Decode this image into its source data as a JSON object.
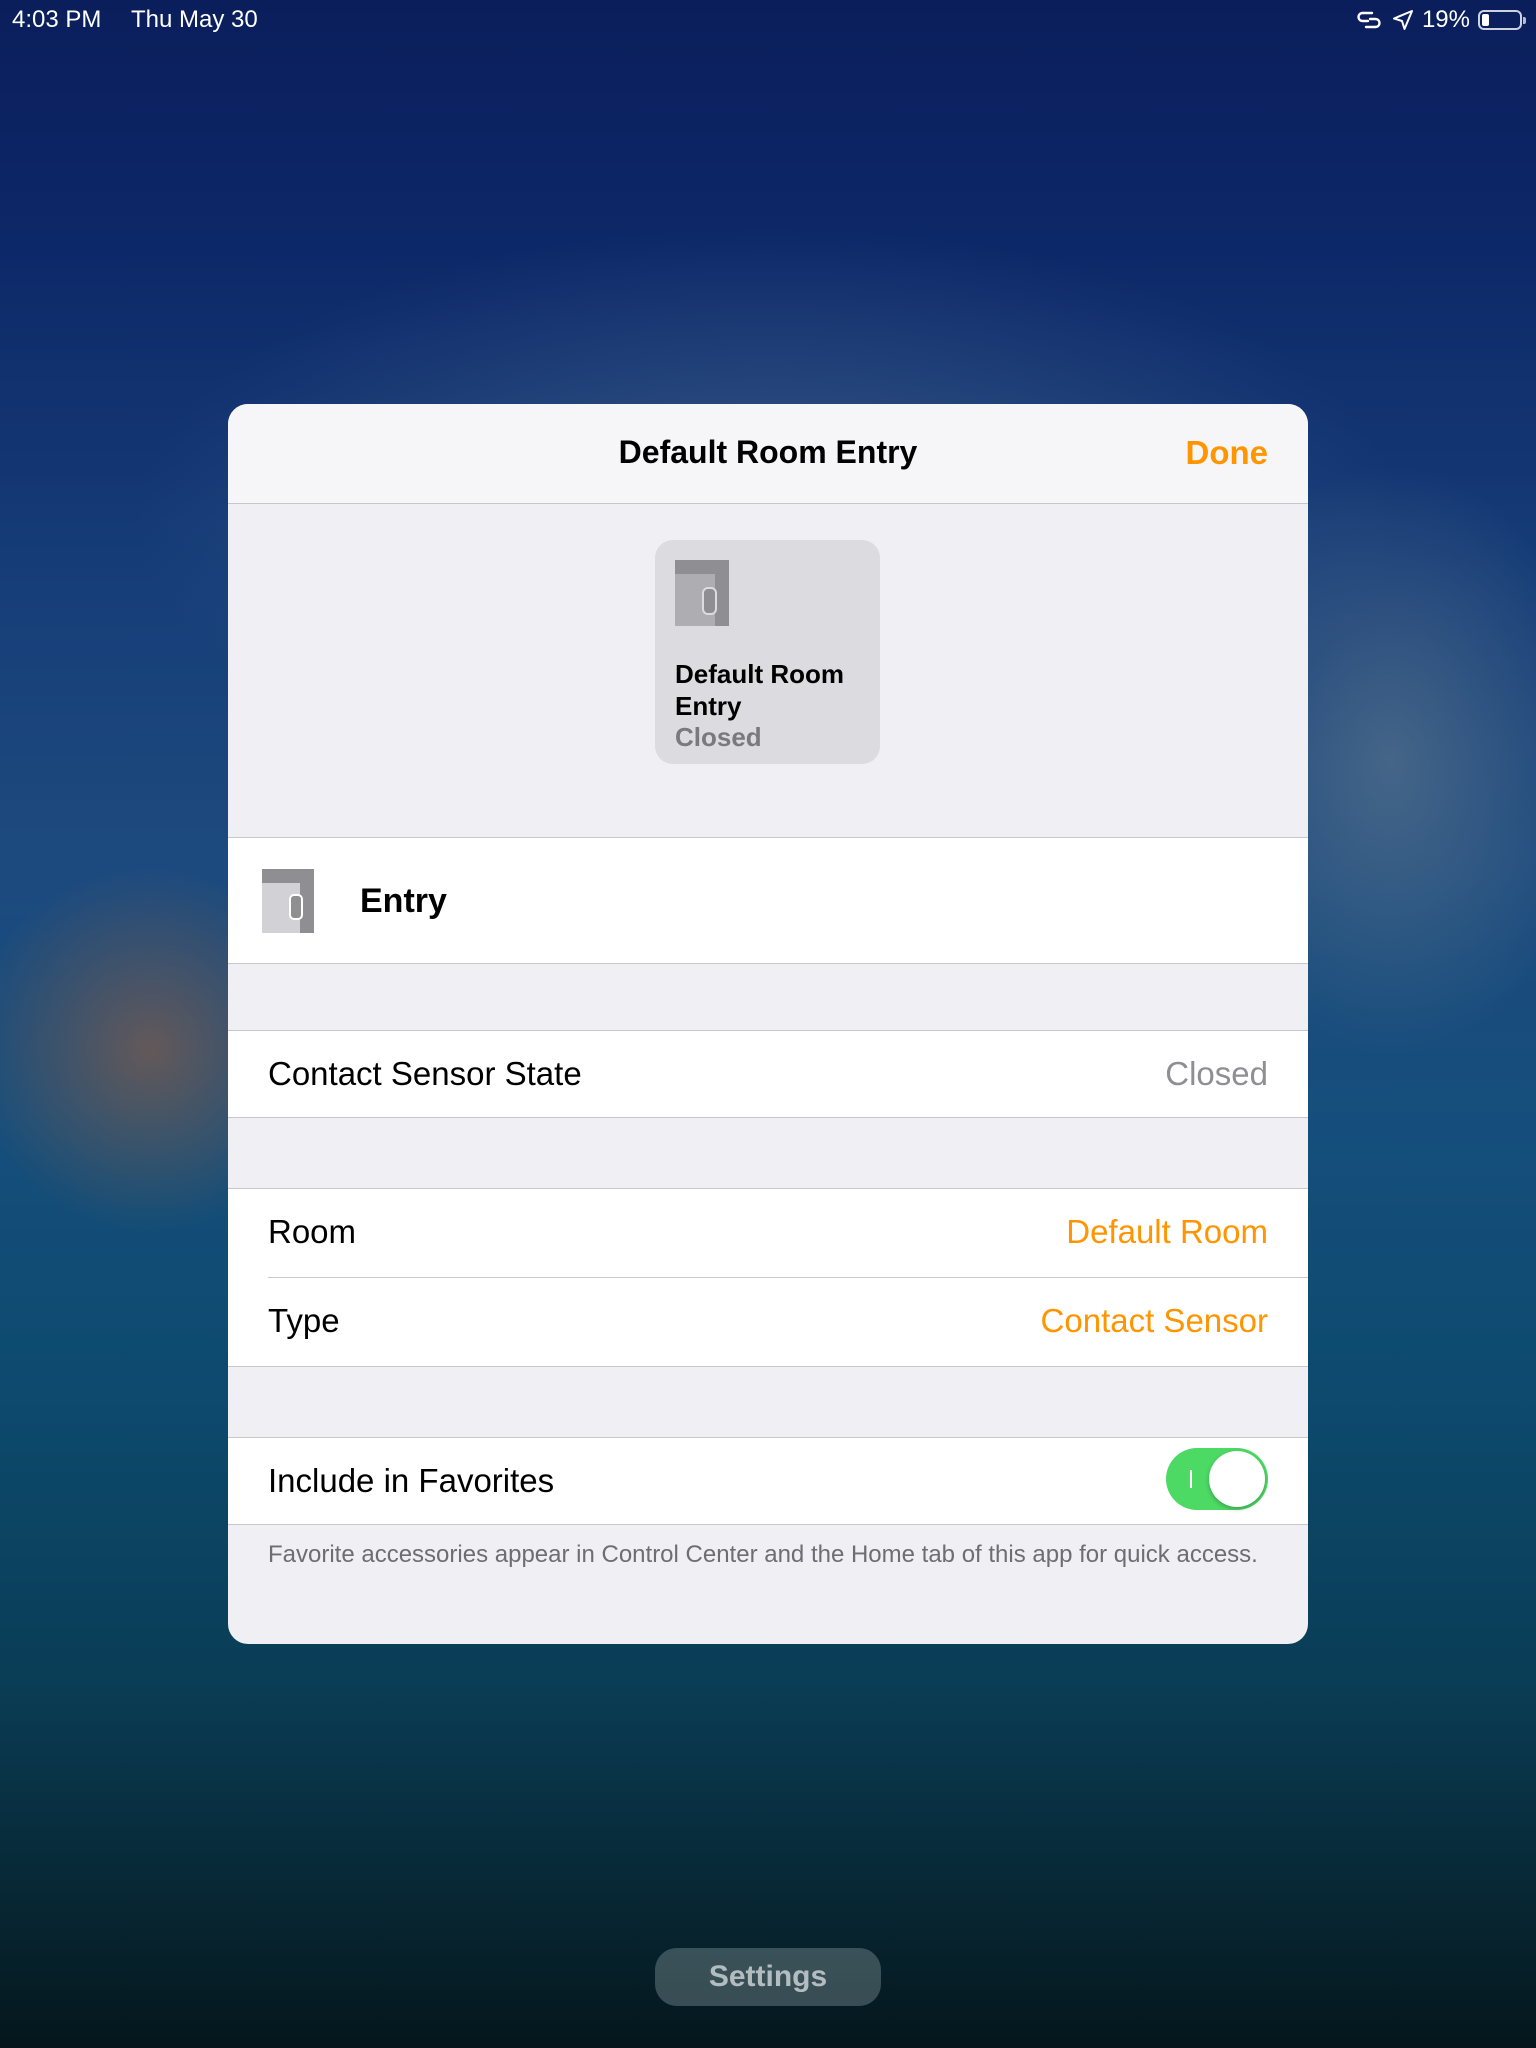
{
  "status_bar": {
    "time": "4:03 PM",
    "date": "Thu May 30",
    "battery_percent": "19%",
    "battery_level": 0.19,
    "icons": [
      "screen-mirroring-icon",
      "location-arrow-icon",
      "battery-icon"
    ]
  },
  "dialog": {
    "title": "Default Room Entry",
    "done_label": "Done",
    "tile": {
      "name": "Default Room Entry",
      "status": "Closed",
      "icon": "contact-sensor-icon"
    },
    "accessory_name": "Entry",
    "contact_sensor": {
      "label": "Contact Sensor State",
      "value": "Closed"
    },
    "room": {
      "label": "Room",
      "value": "Default Room"
    },
    "type": {
      "label": "Type",
      "value": "Contact Sensor"
    },
    "favorites": {
      "label": "Include in Favorites",
      "enabled": true,
      "note": "Favorite accessories appear in Control Center and the Home tab of this app for quick access."
    }
  },
  "settings_button": "Settings",
  "colors": {
    "accent": "#ff9500",
    "toggle_on": "#4cd964",
    "secondary_text": "#8e8e93"
  }
}
